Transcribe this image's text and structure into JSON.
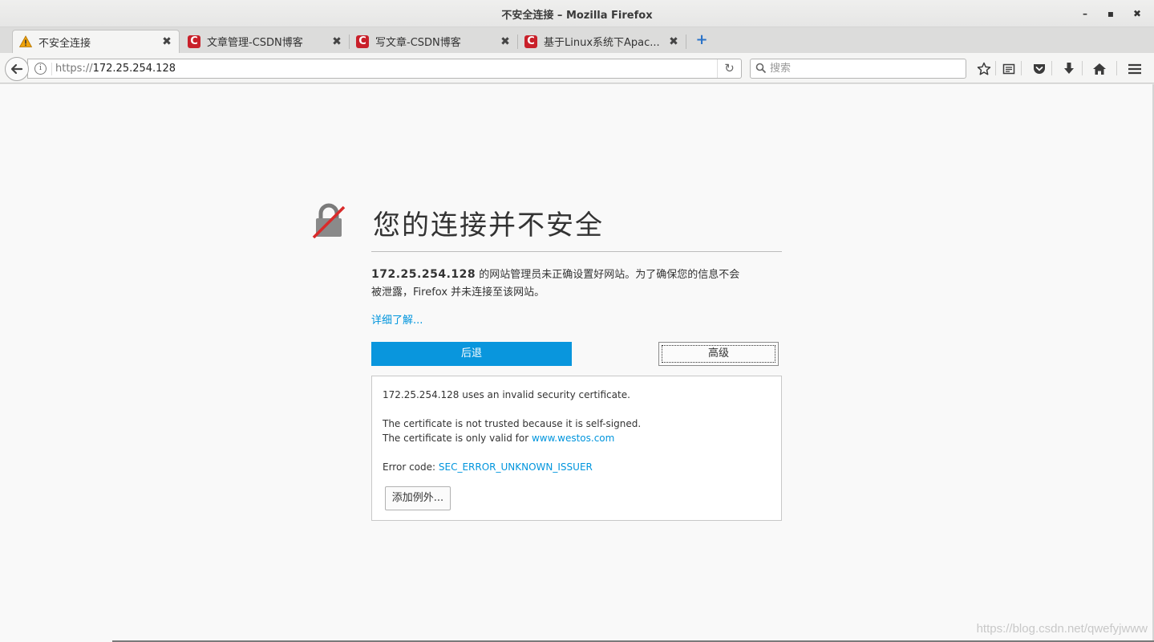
{
  "window": {
    "title": "不安全连接 – Mozilla Firefox",
    "controls": {
      "minimize": "–",
      "maximize": "▪",
      "close": "✖"
    }
  },
  "tabs": [
    {
      "label": "不安全连接",
      "icon": "warning-icon",
      "active": true
    },
    {
      "label": "文章管理-CSDN博客",
      "icon": "csdn-icon",
      "active": false
    },
    {
      "label": "写文章-CSDN博客",
      "icon": "csdn-icon",
      "active": false
    },
    {
      "label": "基于Linux系统下Apac...",
      "icon": "csdn-icon",
      "active": false
    }
  ],
  "tab_close": "✖",
  "new_tab": "+",
  "csdn_letter": "C",
  "navbar": {
    "url_protocol": "https://",
    "url_host": "172.25.254.128",
    "search_placeholder": "搜索"
  },
  "error": {
    "title": "您的连接并不安全",
    "host": "172.25.254.128",
    "description_line1": " 的网站管理员未正确设置好网站。为了确保您的信息不会",
    "description_line2": "被泄露，Firefox 并未连接至该网站。",
    "learn_more": "详细了解...",
    "back_button": "后退",
    "advanced_button": "高级"
  },
  "advanced": {
    "invalid_cert": "172.25.254.128 uses an invalid security certificate.",
    "self_signed": "The certificate is not trusted because it is self-signed.",
    "valid_for_prefix": "The certificate is only valid for ",
    "valid_for_host": "www.westos.com",
    "error_code_prefix": "Error code: ",
    "error_code": "SEC_ERROR_UNKNOWN_ISSUER",
    "add_exception_button": "添加例外..."
  },
  "watermark": "https://blog.csdn.net/qwefyjwww",
  "colors": {
    "accent_blue": "#0996dd",
    "link_blue": "#0095dd",
    "csdn_red": "#c9202a",
    "warning_orange": "#f0a30a",
    "lock_slash_red": "#d92b2b"
  }
}
